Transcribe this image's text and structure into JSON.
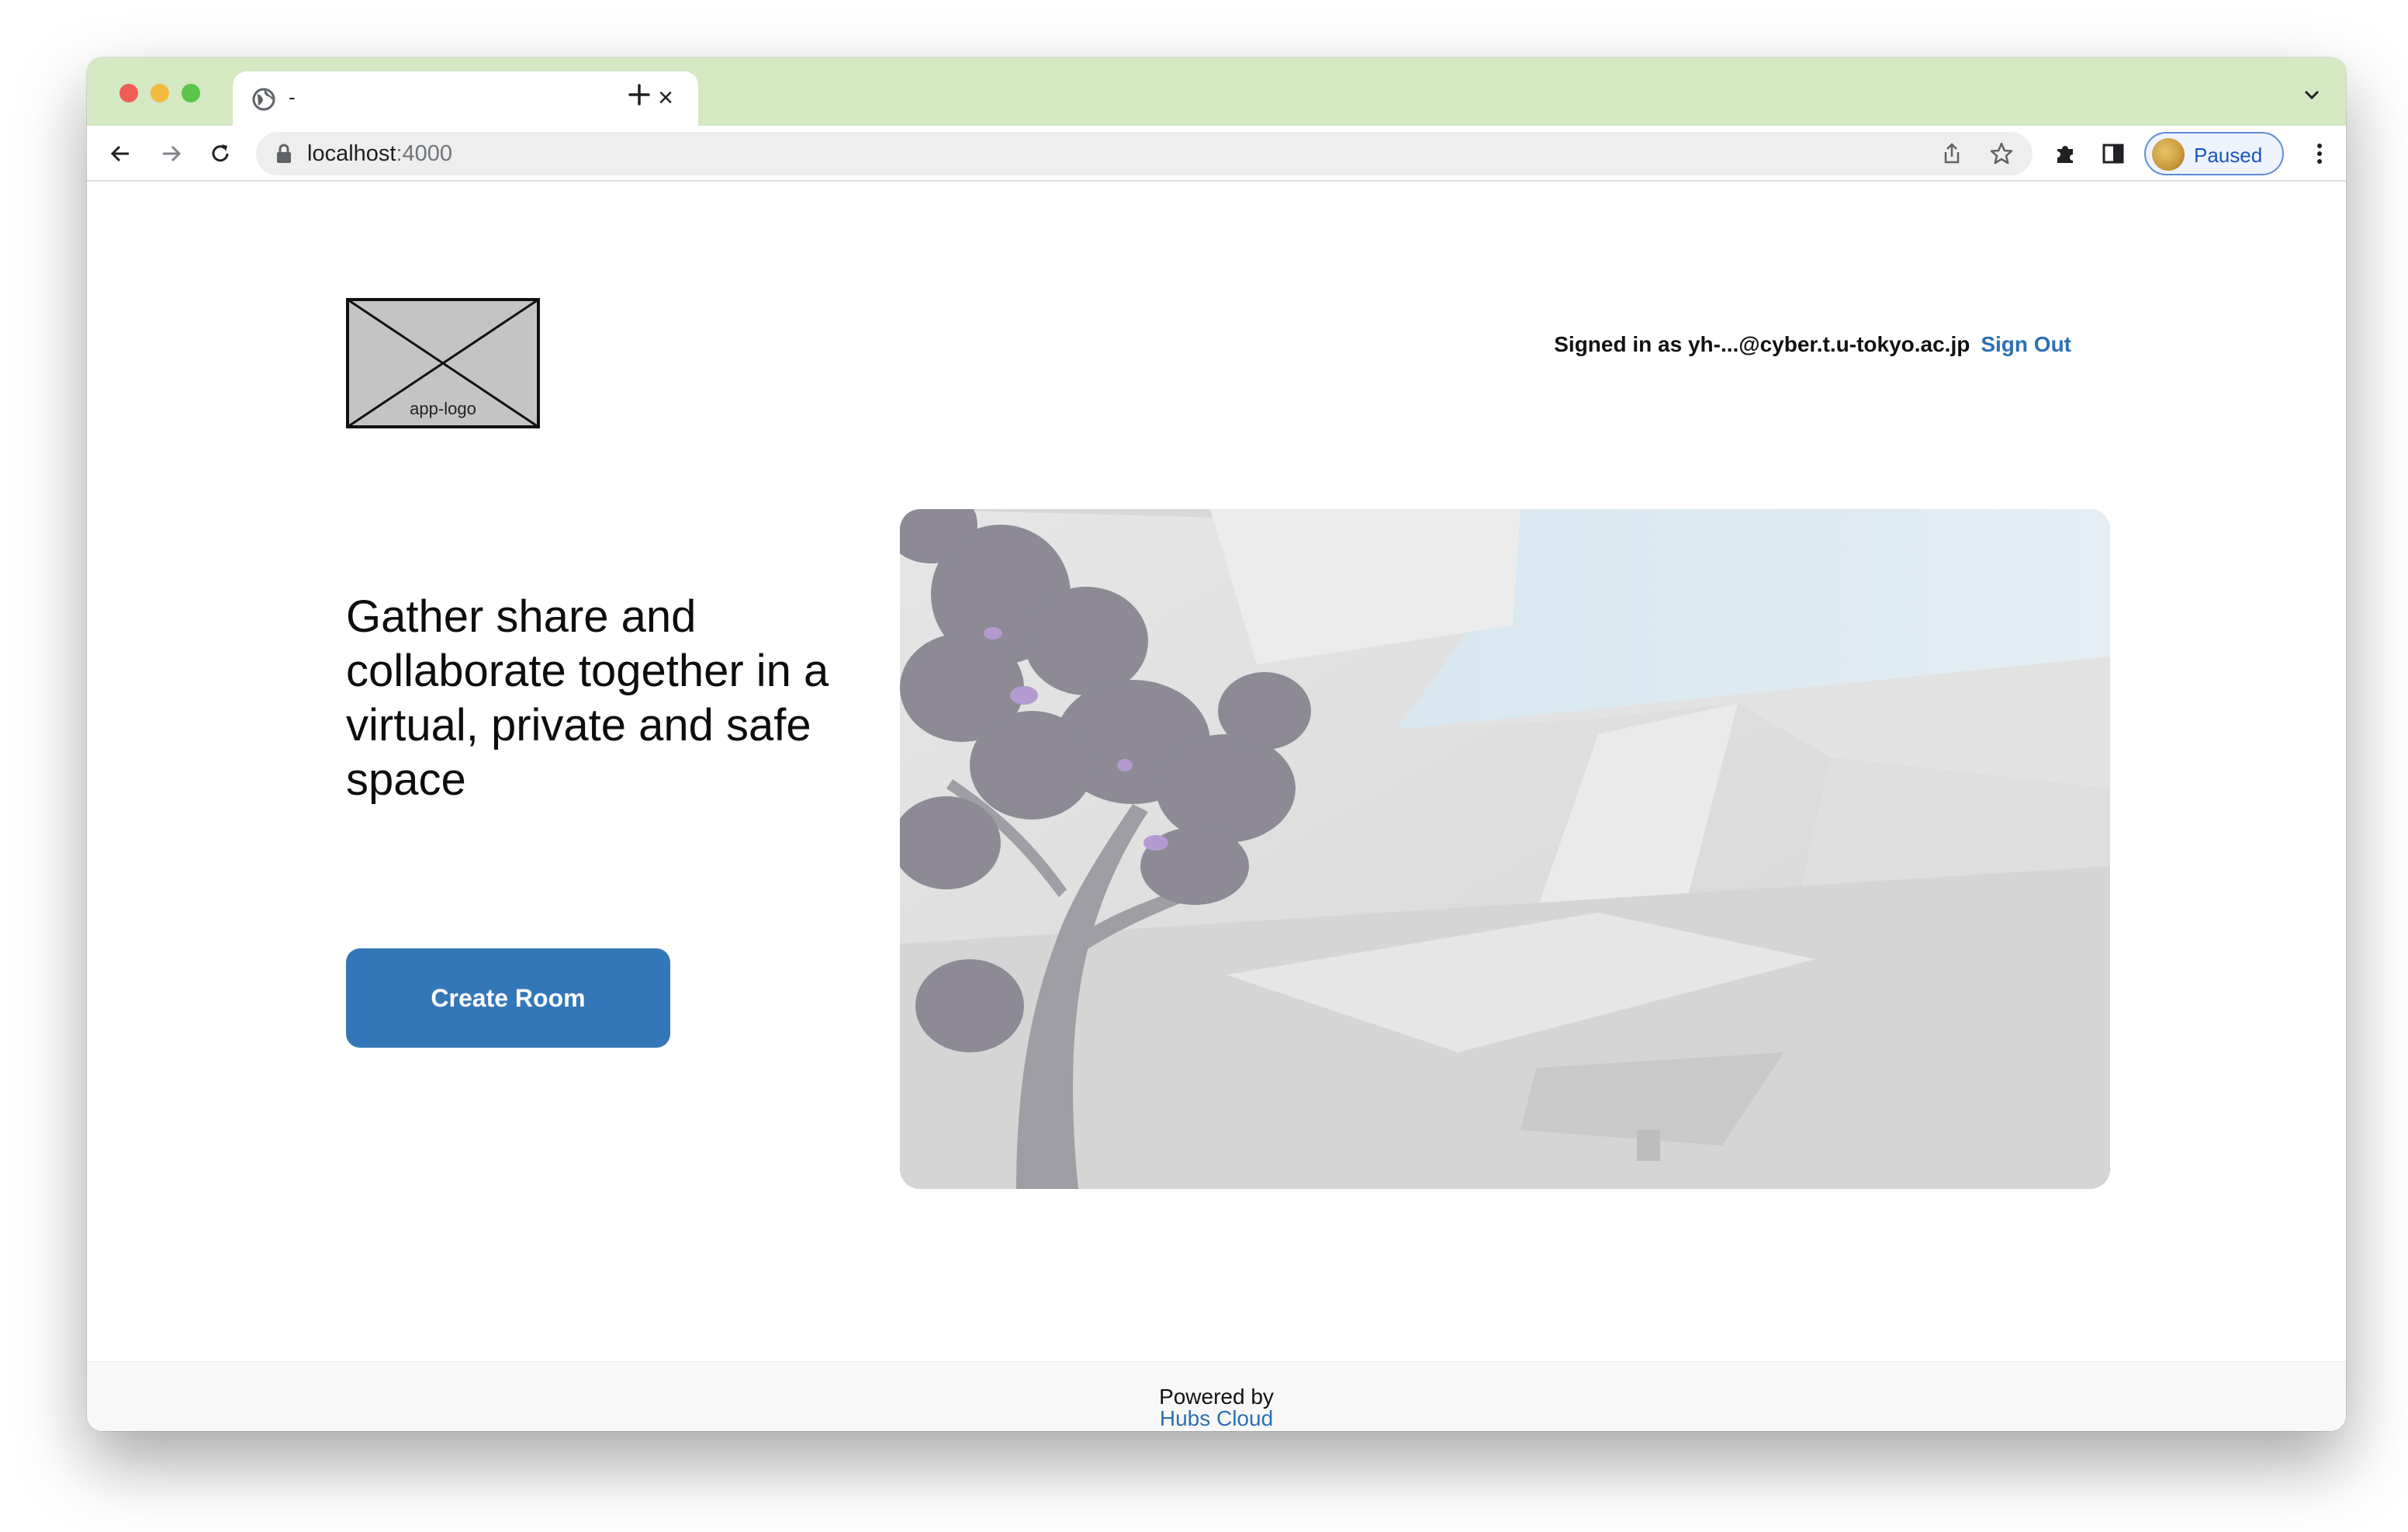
{
  "browser": {
    "tab_title": "-",
    "tab_close": "×",
    "url_host": "localhost",
    "url_port": ":4000",
    "profile_label": "Paused",
    "tab_color": "#d4e8c2"
  },
  "header": {
    "logo_label": "app-logo",
    "signed_in_text": "Signed in as yh-...@cyber.t.u-tokyo.ac.jp",
    "sign_out_label": "Sign Out"
  },
  "hero": {
    "headline": "Gather share and collaborate together in a virtual, private and safe space",
    "create_room_label": "Create Room"
  },
  "footer": {
    "powered_by": "Powered by",
    "brand": "Hubs Cloud"
  },
  "colors": {
    "accent": "#3477b8",
    "link": "#2d70b3"
  },
  "icons": [
    "globe-icon",
    "close-icon",
    "plus-icon",
    "chevron-down-icon",
    "back-icon",
    "forward-icon",
    "reload-icon",
    "lock-icon",
    "share-icon",
    "star-icon",
    "extensions-icon",
    "side-panel-icon",
    "avatar",
    "kebab-menu-icon"
  ]
}
